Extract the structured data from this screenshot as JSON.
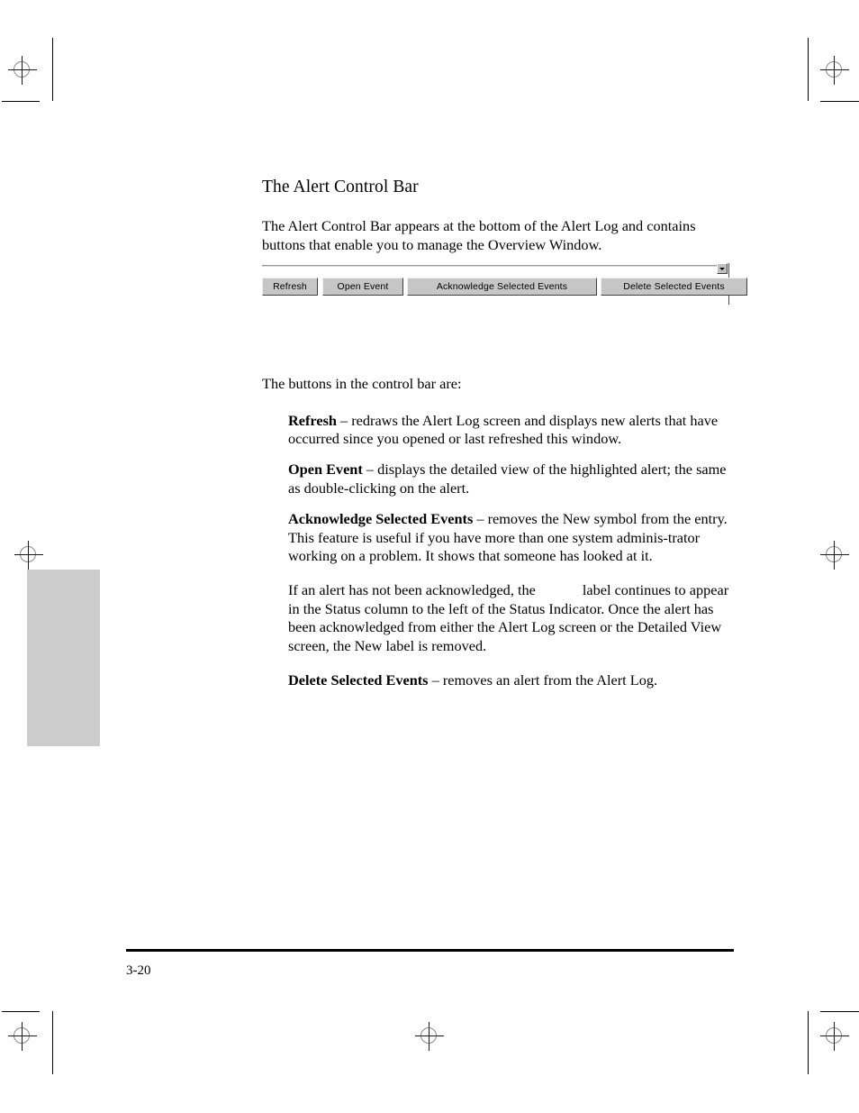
{
  "page": {
    "number": "3-20"
  },
  "content": {
    "heading": "The Alert Control Bar",
    "intro": "The Alert Control Bar appears at the bottom of the Alert Log and contains buttons that enable you to manage the Overview Window.",
    "lead_in": "The buttons in the control bar are:",
    "bullets": [
      {
        "term": "Refresh",
        "description": " – redraws the Alert Log screen and displays new alerts that have occurred since you opened or last refreshed this window."
      },
      {
        "term": "Open Event",
        "description": " – displays the detailed view of the highlighted alert; the same as double-clicking on the alert."
      },
      {
        "term": "Acknowledge Selected Events",
        "description": " – removes the New symbol from the entry. This feature is useful if you have more than one system adminis-trator working on a problem. It shows that someone has looked at it."
      }
    ],
    "note": {
      "before_blank": "If an alert has not been acknowledged, the",
      "after_blank": "label continues to appear in the Status column to the left of the Status Indicator. Once the alert has been acknowledged from either the Alert Log screen or the Detailed View screen, the New label is removed."
    },
    "final_bullet": {
      "term": "Delete Selected Events",
      "description": " – removes an alert from the Alert Log."
    }
  },
  "figure": {
    "name": "alert-control-bar-screenshot",
    "buttons": [
      {
        "label": "Refresh"
      },
      {
        "label": "Open Event"
      },
      {
        "label": "Acknowledge Selected Events"
      },
      {
        "label": "Delete Selected Events"
      }
    ],
    "scroll_arrow_icon": "scroll-down-arrow-icon"
  },
  "colors": {
    "button_face": "#c6c6c6",
    "button_highlight": "#efefef",
    "button_shadow": "#404040",
    "thumb_tab": "#cccccc",
    "text": "#000000"
  }
}
